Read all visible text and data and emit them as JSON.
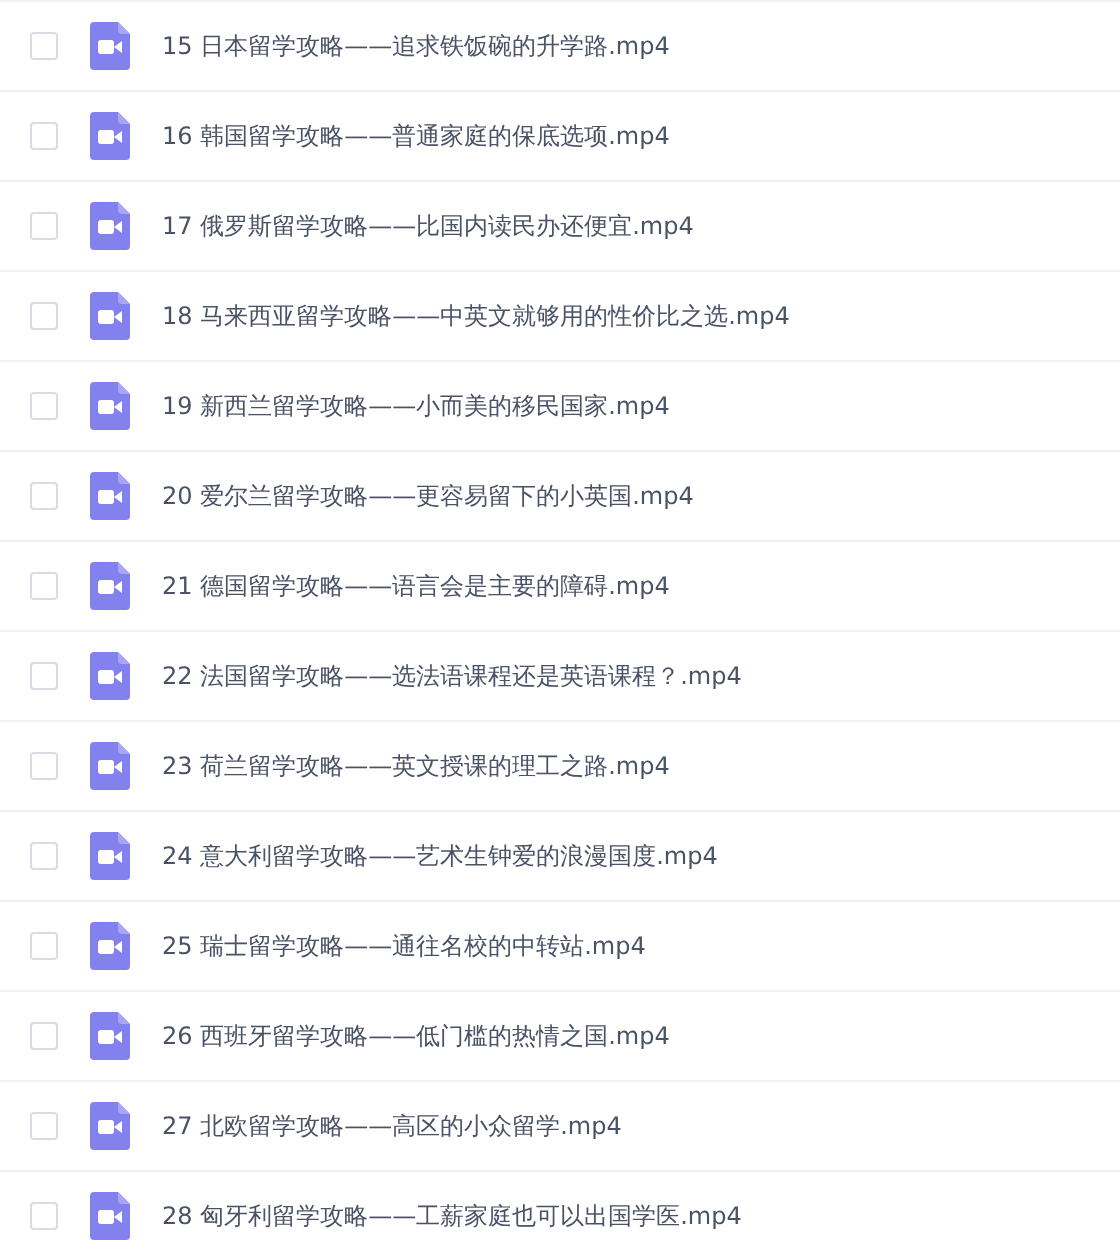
{
  "files": [
    {
      "name": "15 日本留学攻略——追求铁饭碗的升学路.mp4",
      "checked": false
    },
    {
      "name": "16 韩国留学攻略——普通家庭的保底选项.mp4",
      "checked": false
    },
    {
      "name": "17 俄罗斯留学攻略——比国内读民办还便宜.mp4",
      "checked": false
    },
    {
      "name": "18 马来西亚留学攻略——中英文就够用的性价比之选.mp4",
      "checked": false
    },
    {
      "name": "19 新西兰留学攻略——小而美的移民国家.mp4",
      "checked": false
    },
    {
      "name": "20 爱尔兰留学攻略——更容易留下的小英国.mp4",
      "checked": false
    },
    {
      "name": "21 德国留学攻略——语言会是主要的障碍.mp4",
      "checked": false
    },
    {
      "name": "22 法国留学攻略——选法语课程还是英语课程？.mp4",
      "checked": false
    },
    {
      "name": "23 荷兰留学攻略——英文授课的理工之路.mp4",
      "checked": false
    },
    {
      "name": "24 意大利留学攻略——艺术生钟爱的浪漫国度.mp4",
      "checked": false
    },
    {
      "name": "25 瑞士留学攻略——通往名校的中转站.mp4",
      "checked": false
    },
    {
      "name": "26 西班牙留学攻略——低门槛的热情之国.mp4",
      "checked": false
    },
    {
      "name": "27 北欧留学攻略——高区的小众留学.mp4",
      "checked": false
    },
    {
      "name": "28 匈牙利留学攻略——工薪家庭也可以出国学医.mp4",
      "checked": false
    }
  ]
}
